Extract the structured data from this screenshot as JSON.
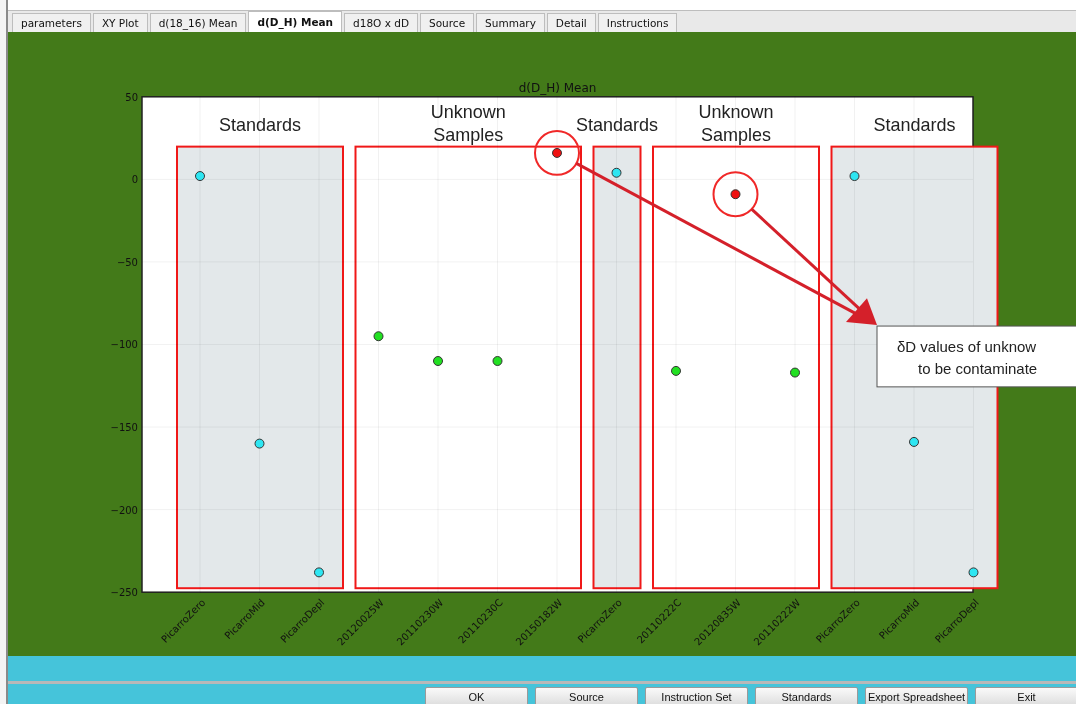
{
  "tabs": [
    {
      "label": "parameters",
      "selected": false
    },
    {
      "label": "XY Plot",
      "selected": false
    },
    {
      "label": "d(18_16) Mean",
      "selected": false
    },
    {
      "label": "d(D_H) Mean",
      "selected": true
    },
    {
      "label": "d18O x dD",
      "selected": false
    },
    {
      "label": "Source",
      "selected": false
    },
    {
      "label": "Summary",
      "selected": false
    },
    {
      "label": "Detail",
      "selected": false
    },
    {
      "label": "Instructions",
      "selected": false
    }
  ],
  "chart": {
    "chart_data": {
      "type": "scatter",
      "title": "d(D_H) Mean",
      "categories": [
        "PicarroZero",
        "PicarroMid",
        "PicarroDepl",
        "20120025W",
        "20110230W",
        "20110230C",
        "20150182W",
        "PicarroZero",
        "20110222C",
        "20120835W",
        "20110222W",
        "PicarroZero",
        "PicarroMid",
        "PicarroDepl"
      ],
      "series": [
        {
          "color": "#2ee6f2",
          "values": [
            2,
            -160,
            -238,
            null,
            null,
            null,
            null,
            4,
            null,
            null,
            null,
            2,
            -159,
            -238
          ]
        },
        {
          "color": "#22e022",
          "values": [
            null,
            null,
            null,
            -95,
            -110,
            -110,
            null,
            null,
            -116,
            null,
            -117,
            null,
            null,
            null
          ]
        },
        {
          "color": "#ee1111",
          "values": [
            null,
            null,
            null,
            null,
            null,
            null,
            16,
            null,
            null,
            -9,
            null,
            null,
            null,
            null
          ]
        }
      ],
      "ylim": [
        -250,
        50
      ],
      "yticks": [
        -250,
        -200,
        -150,
        -100,
        -50,
        0,
        50
      ],
      "grid": true
    },
    "callouts": [
      {
        "lines": [
          "δD values of unknow",
          "to be contaminate"
        ]
      }
    ],
    "groups": [
      {
        "label": "Standards",
        "kind": "standard"
      },
      {
        "label": "Unknown Samples",
        "kind": "unknown"
      },
      {
        "label": "Standards",
        "kind": "standard"
      },
      {
        "label": "Unknown Samples",
        "kind": "unknown"
      },
      {
        "label": "Standards",
        "kind": "standard"
      }
    ]
  },
  "buttons": [
    "OK",
    "Source",
    "Instruction Set",
    "Standards",
    "Export Spreadsheet",
    "Exit"
  ]
}
